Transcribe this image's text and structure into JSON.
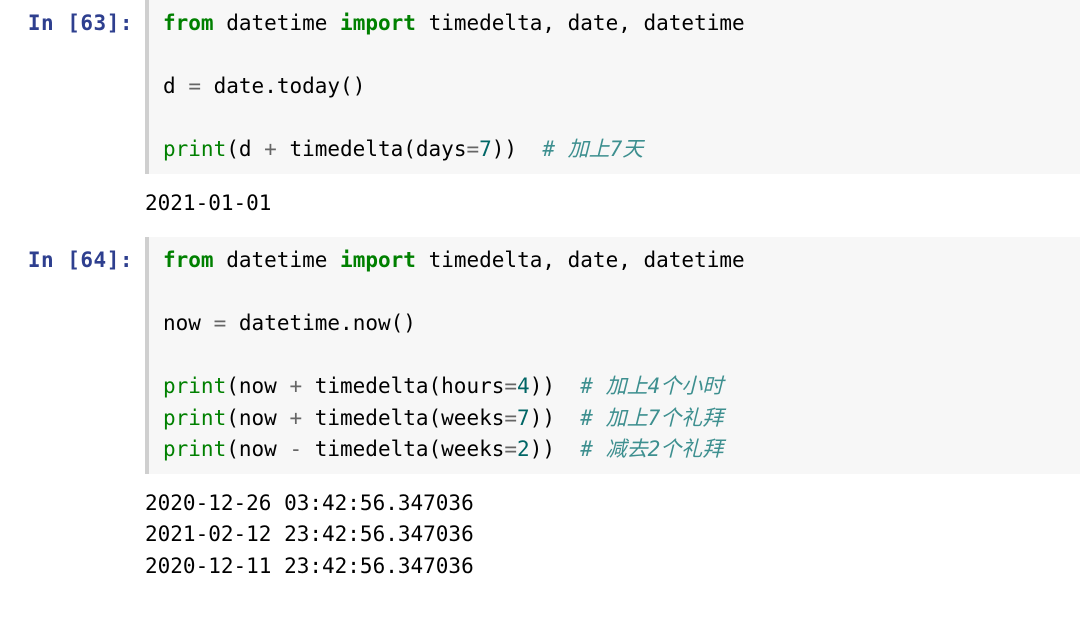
{
  "cells": [
    {
      "prompt": "In [63]:",
      "code": {
        "l1_from": "from",
        "l1_mod": "datetime",
        "l1_import": "import",
        "l1_names": "timedelta, date, datetime",
        "l3_var": "d",
        "l3_eq": "=",
        "l3_expr": "date.today()",
        "l5_fn": "print",
        "l5_open": "(d ",
        "l5_op": "+",
        "l5_mid": " timedelta(days",
        "l5_eq": "=",
        "l5_num": "7",
        "l5_close": "))  ",
        "l5_cmt": "# 加上7天"
      },
      "output": [
        "2021-01-01"
      ]
    },
    {
      "prompt": "In [64]:",
      "code": {
        "l1_from": "from",
        "l1_mod": "datetime",
        "l1_import": "import",
        "l1_names": "timedelta, date, datetime",
        "l3_var": "now",
        "l3_eq": "=",
        "l3_expr": "datetime.now()",
        "l5_fn": "print",
        "l5_open": "(now ",
        "l5_op": "+",
        "l5_mid": " timedelta(hours",
        "l5_eq": "=",
        "l5_num": "4",
        "l5_close": "))  ",
        "l5_cmt": "# 加上4个小时",
        "l6_fn": "print",
        "l6_open": "(now ",
        "l6_op": "+",
        "l6_mid": " timedelta(weeks",
        "l6_eq": "=",
        "l6_num": "7",
        "l6_close": "))  ",
        "l6_cmt": "# 加上7个礼拜",
        "l7_fn": "print",
        "l7_open": "(now ",
        "l7_op": "-",
        "l7_mid": " timedelta(weeks",
        "l7_eq": "=",
        "l7_num": "2",
        "l7_close": "))  ",
        "l7_cmt": "# 减去2个礼拜"
      },
      "output": [
        "2020-12-26 03:42:56.347036",
        "2021-02-12 23:42:56.347036",
        "2020-12-11 23:42:56.347036"
      ]
    }
  ]
}
